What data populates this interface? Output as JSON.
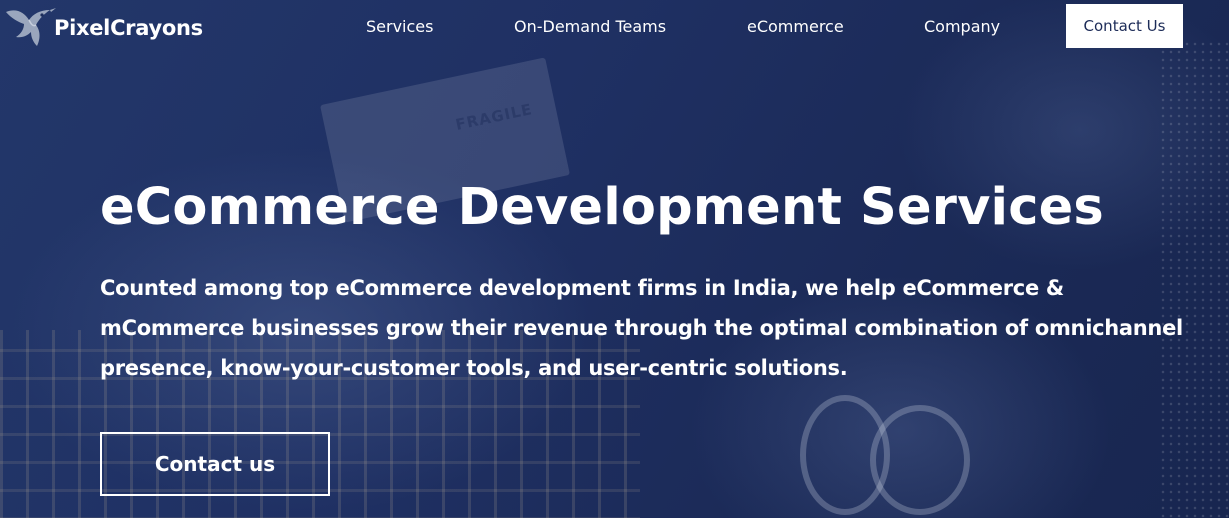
{
  "brand": {
    "name": "PixelCrayons",
    "logo_icon": "hummingbird-logo-icon"
  },
  "nav": {
    "items": [
      {
        "label": "Services"
      },
      {
        "label": "On-Demand Teams"
      },
      {
        "label": "eCommerce"
      },
      {
        "label": "Company"
      }
    ],
    "cta_label": "Contact Us"
  },
  "hero": {
    "title": "eCommerce Development Services",
    "description": "Counted among top eCommerce development firms in India, we help eCommerce & mCommerce businesses grow their revenue through the optimal combination of omnichannel presence, know-your-customer tools, and user-centric solutions.",
    "cta_label": "Contact us",
    "background_text": "FRAGILE"
  },
  "colors": {
    "background": "#1d2e5c",
    "text": "#ffffff",
    "nav_button_text": "#1d2c58"
  }
}
